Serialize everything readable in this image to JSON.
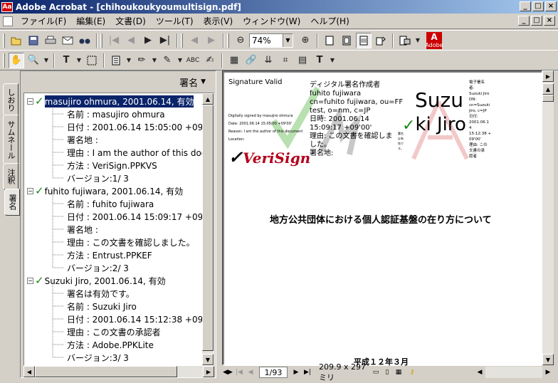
{
  "window": {
    "title": "Adobe Acrobat - [chihoukoukyoumultisign.pdf]",
    "app_icon": "Aa",
    "min": "_",
    "max": "□",
    "close": "×"
  },
  "menu": {
    "items": [
      "ファイル(F)",
      "編集(E)",
      "文書(D)",
      "ツール(T)",
      "表示(V)",
      "ウィンドウ(W)",
      "ヘルプ(H)"
    ]
  },
  "toolbar": {
    "zoom": "74%",
    "adobe_label": "Adobe"
  },
  "tabs": {
    "bookmarks": "しおり",
    "thumbnails": "サムネール",
    "annotations": "注釈",
    "signatures": "署名"
  },
  "signature_panel": {
    "header": "署名",
    "tree": [
      {
        "kind": "sig",
        "text": "masujiro ohmura, 2001.06.14, 有効",
        "selected": true
      },
      {
        "kind": "detail",
        "text": "名前 : masujiro ohmura"
      },
      {
        "kind": "detail",
        "text": "日付 : 2001.06.14 15:05:00 +09'00'"
      },
      {
        "kind": "detail",
        "text": "署名地 :"
      },
      {
        "kind": "detail",
        "text": "理由 : I am the author of this document"
      },
      {
        "kind": "detail",
        "text": "方法 : VeriSign.PPKVS"
      },
      {
        "kind": "detail",
        "text": "バージョン:1/ 3"
      },
      {
        "kind": "sig",
        "text": "fuhito fujiwara, 2001.06.14, 有効",
        "selected": false
      },
      {
        "kind": "detail",
        "text": "名前 : fuhito fujiwara"
      },
      {
        "kind": "detail",
        "text": "日付 : 2001.06.14 15:09:17 +09'00'"
      },
      {
        "kind": "detail",
        "text": "署名地 :"
      },
      {
        "kind": "detail",
        "text": "理由 : この文書を確認しました。"
      },
      {
        "kind": "detail",
        "text": "方法 : Entrust.PPKEF"
      },
      {
        "kind": "detail",
        "text": "バージョン:2/ 3"
      },
      {
        "kind": "sig",
        "text": "Suzuki Jiro, 2001.06.14, 有効",
        "selected": false
      },
      {
        "kind": "detail",
        "text": "署名は有効です。"
      },
      {
        "kind": "detail",
        "text": "名前 : Suzuki Jiro"
      },
      {
        "kind": "detail",
        "text": "日付 : 2001.06.14 15:12:38 +09'00'"
      },
      {
        "kind": "detail",
        "text": "理由 : この文書の承認者"
      },
      {
        "kind": "detail",
        "text": "方法 : Adobe.PPKLite"
      },
      {
        "kind": "detail",
        "text": "バージョン:3/ 3"
      }
    ]
  },
  "document": {
    "sig1_title": "Signature Valid",
    "sig1_small": [
      "Digitally signed by masujiro ohmura",
      "Date: 2001.06.14 15:05:00 +09'00'",
      "Reason: I am the author of this document",
      "Location:"
    ],
    "verisign": "VeriSign",
    "sig2_lines": [
      "ディジタル署名作成者",
      "fuhito fujiwara",
      "cn=fuhito fujiwara, ou=FF",
      "test, o=nm, c=JP",
      "日時: 2001.06.14",
      "15:09:17 +09'00'",
      "理由: この文書を確認しま",
      "した。",
      "署名地:"
    ],
    "sig3_name_top": "Suzu",
    "sig3_name_bottom": "ki Jiro",
    "sig3_small_left": [
      "署名",
      "は有",
      "効で",
      "す。"
    ],
    "sig3_small_right": [
      "電子署名",
      "者:",
      "Suzuki Jiro",
      "DN:",
      "cn=Suzuki",
      "Jiro, c=JP",
      "日付:",
      "2001.06.1",
      "4",
      "15:12:38 +",
      "09'00'",
      "理由: この",
      "文書の承",
      "認者"
    ],
    "main_title": "地方公共団体における個人認証基盤の在り方について",
    "date": "平成１２年３月"
  },
  "status": {
    "page": "1/93",
    "size": "209.9 x 297 ミリ"
  },
  "colors": {
    "title_start": "#0a246a",
    "check": "#1a8a1a",
    "verisign_red": "#b3001b"
  }
}
